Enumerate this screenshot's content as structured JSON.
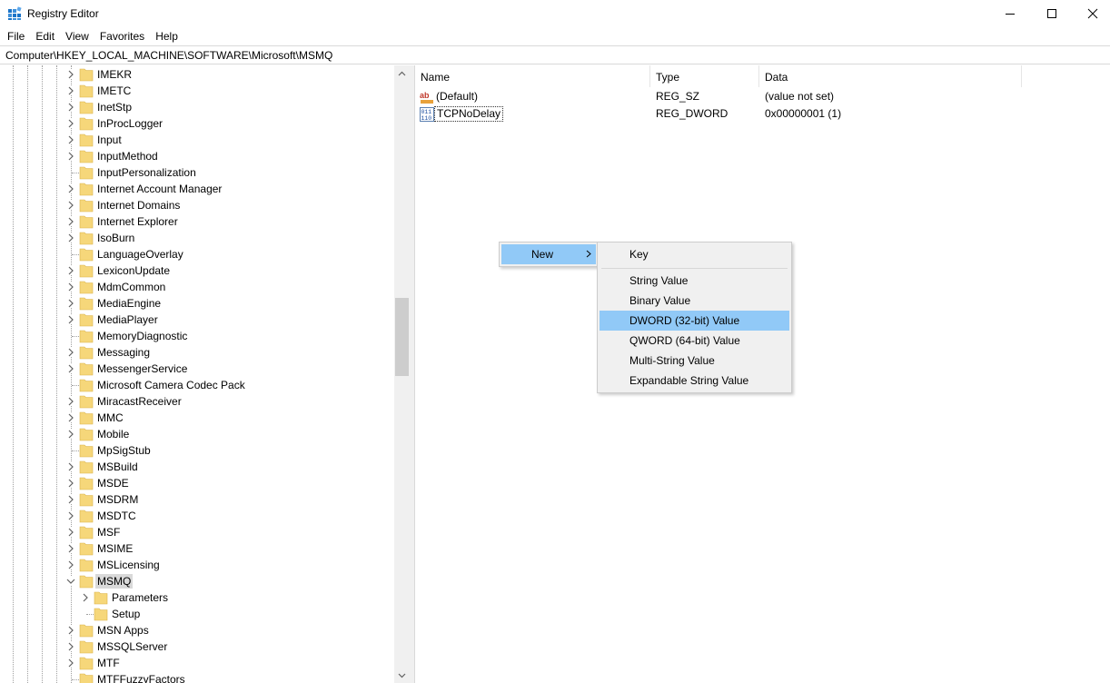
{
  "window": {
    "title": "Registry Editor",
    "icon": "regedit-icon"
  },
  "menu": [
    "File",
    "Edit",
    "View",
    "Favorites",
    "Help"
  ],
  "address": "Computer\\HKEY_LOCAL_MACHINE\\SOFTWARE\\Microsoft\\MSMQ",
  "tree": {
    "items": [
      {
        "label": "IMEKR",
        "expandable": true
      },
      {
        "label": "IMETC",
        "expandable": true
      },
      {
        "label": "InetStp",
        "expandable": true
      },
      {
        "label": "InProcLogger",
        "expandable": true
      },
      {
        "label": "Input",
        "expandable": true
      },
      {
        "label": "InputMethod",
        "expandable": true
      },
      {
        "label": "InputPersonalization",
        "expandable": false
      },
      {
        "label": "Internet Account Manager",
        "expandable": true
      },
      {
        "label": "Internet Domains",
        "expandable": true
      },
      {
        "label": "Internet Explorer",
        "expandable": true
      },
      {
        "label": "IsoBurn",
        "expandable": true
      },
      {
        "label": "LanguageOverlay",
        "expandable": false
      },
      {
        "label": "LexiconUpdate",
        "expandable": true
      },
      {
        "label": "MdmCommon",
        "expandable": true
      },
      {
        "label": "MediaEngine",
        "expandable": true
      },
      {
        "label": "MediaPlayer",
        "expandable": true
      },
      {
        "label": "MemoryDiagnostic",
        "expandable": false
      },
      {
        "label": "Messaging",
        "expandable": true
      },
      {
        "label": "MessengerService",
        "expandable": true
      },
      {
        "label": "Microsoft Camera Codec Pack",
        "expandable": false
      },
      {
        "label": "MiracastReceiver",
        "expandable": true
      },
      {
        "label": "MMC",
        "expandable": true
      },
      {
        "label": "Mobile",
        "expandable": true
      },
      {
        "label": "MpSigStub",
        "expandable": false
      },
      {
        "label": "MSBuild",
        "expandable": true
      },
      {
        "label": "MSDE",
        "expandable": true
      },
      {
        "label": "MSDRM",
        "expandable": true
      },
      {
        "label": "MSDTC",
        "expandable": true
      },
      {
        "label": "MSF",
        "expandable": true
      },
      {
        "label": "MSIME",
        "expandable": true
      },
      {
        "label": "MSLicensing",
        "expandable": true
      },
      {
        "label": "MSMQ",
        "expandable": true,
        "expanded": true,
        "selected": true
      },
      {
        "label": "Parameters",
        "expandable": true,
        "child": true
      },
      {
        "label": "Setup",
        "expandable": false,
        "child": true
      },
      {
        "label": "MSN Apps",
        "expandable": true
      },
      {
        "label": "MSSQLServer",
        "expandable": true
      },
      {
        "label": "MTF",
        "expandable": true
      },
      {
        "label": "MTFFuzzyFactors",
        "expandable": false
      }
    ]
  },
  "list": {
    "columns": [
      "Name",
      "Type",
      "Data"
    ],
    "rows": [
      {
        "name": "(Default)",
        "type": "REG_SZ",
        "data": "(value not set)",
        "icon": "string-value-icon"
      },
      {
        "name": "TCPNoDelay",
        "type": "REG_DWORD",
        "data": "0x00000001 (1)",
        "icon": "binary-value-icon"
      }
    ]
  },
  "context_menu": {
    "new_label": "New",
    "submenu": [
      {
        "label": "Key"
      },
      {
        "label": "String Value"
      },
      {
        "label": "Binary Value"
      },
      {
        "label": "DWORD (32-bit) Value",
        "highlighted": true
      },
      {
        "label": "QWORD (64-bit) Value"
      },
      {
        "label": "Multi-String Value"
      },
      {
        "label": "Expandable String Value"
      }
    ]
  },
  "colors": {
    "highlight": "#91c9f7",
    "folder": "#f6d77a",
    "selection": "#d9d9d9"
  }
}
